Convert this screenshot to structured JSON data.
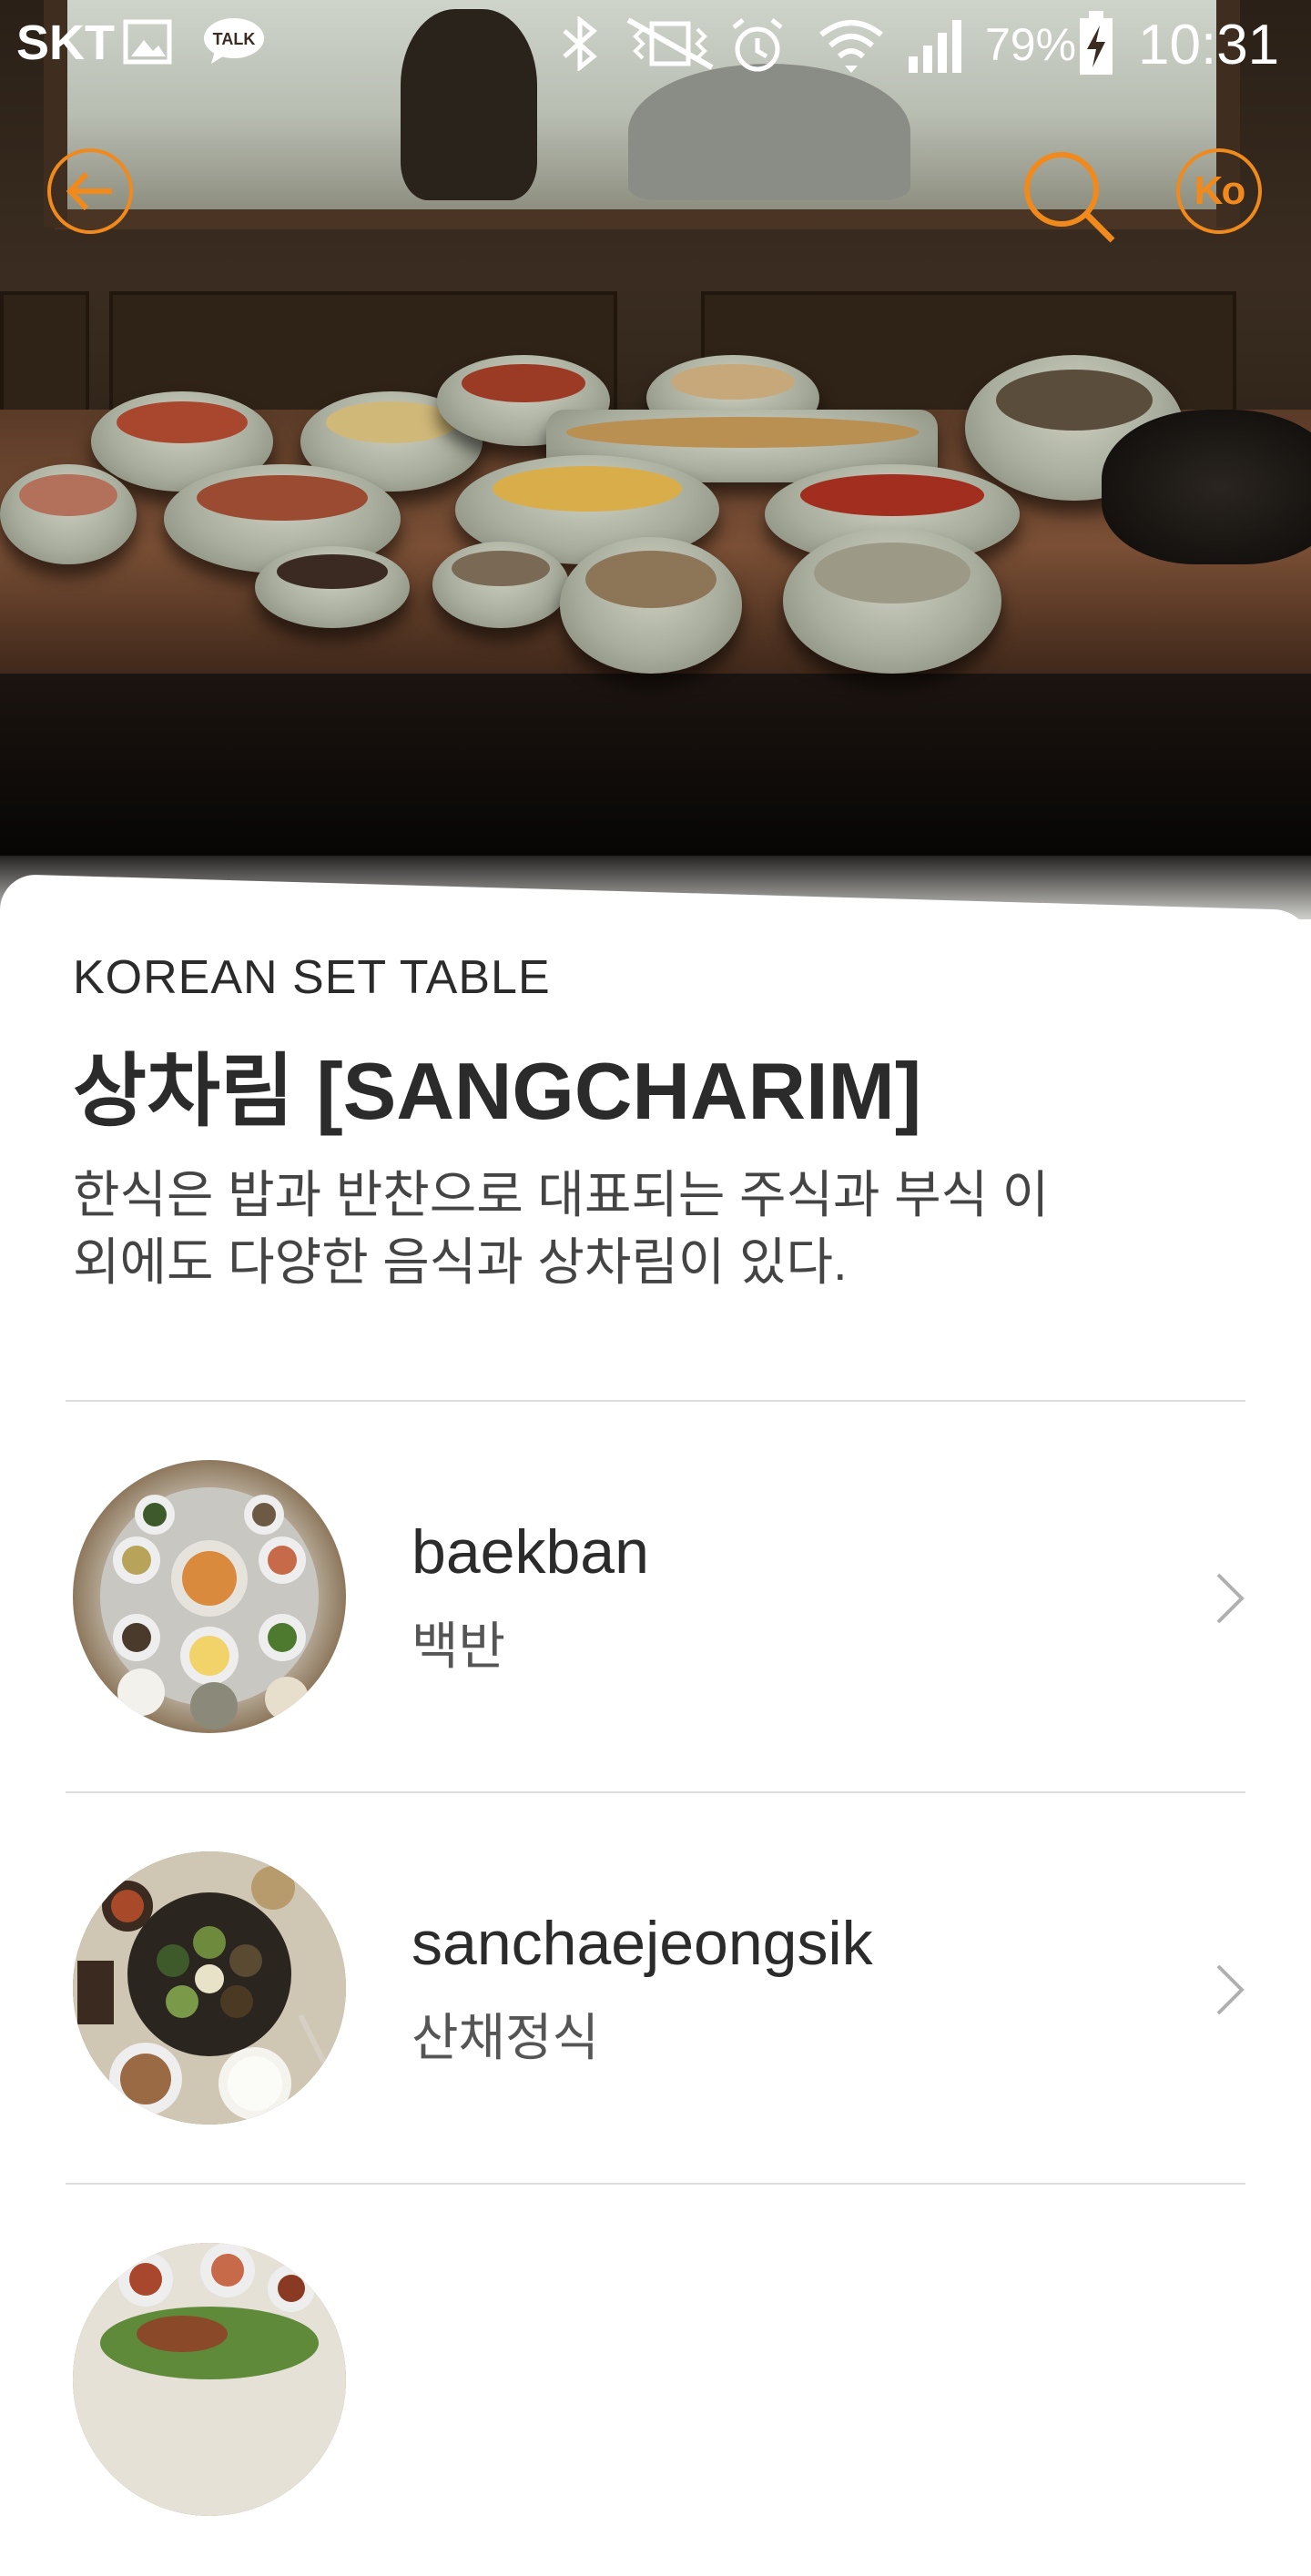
{
  "status_bar": {
    "carrier": "SKT",
    "battery": "79%",
    "time": "10:31",
    "icons": [
      "gallery-icon",
      "kakaotalk-icon",
      "bluetooth-icon",
      "vibrate-icon",
      "alarm-icon",
      "wifi-icon",
      "signal-icon",
      "battery-charging-icon"
    ],
    "talk_label": "TALK"
  },
  "nav": {
    "back_icon": "arrow-left-icon",
    "search_icon": "search-icon",
    "language_label": "Ko"
  },
  "header": {
    "category": "KOREAN SET TABLE",
    "title": "상차림 [SANGCHARIM]",
    "description": "한식은 밥과 반찬으로 대표되는 주식과 부식 이외에도 다양한 음식과 상차림이 있다."
  },
  "items": [
    {
      "name_en": "baekban",
      "name_ko": "백반"
    },
    {
      "name_en": "sanchaejeongsik",
      "name_ko": "산채정식"
    },
    {
      "name_en": "",
      "name_ko": ""
    }
  ],
  "colors": {
    "accent": "#f08a1c",
    "text": "#2b2b2b",
    "divider": "#dcdcdc"
  }
}
